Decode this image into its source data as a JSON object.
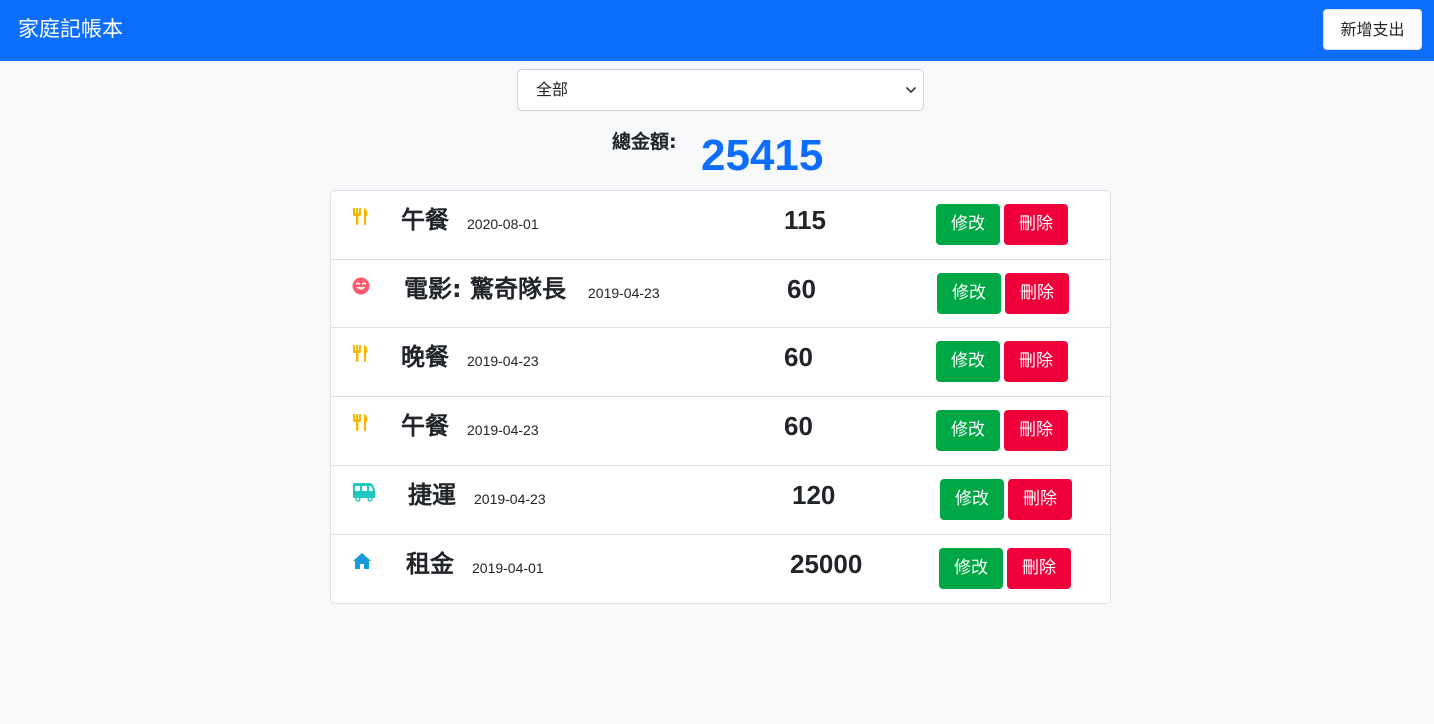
{
  "navbar": {
    "brand": "家庭記帳本",
    "add_button": "新增支出"
  },
  "filter": {
    "selected": "全部"
  },
  "summary": {
    "label": "總金額:",
    "total": "25415"
  },
  "row_actions": {
    "edit_label": "修改",
    "delete_label": "刪除"
  },
  "items": [
    {
      "icon": "utensils-icon",
      "icon_color": "#f5b700",
      "name": "午餐",
      "date": "2020-08-01",
      "amount": "115"
    },
    {
      "icon": "smile-icon",
      "icon_color": "#ff5a6e",
      "name": "電影: 驚奇隊長",
      "date": "2019-04-23",
      "amount": "60"
    },
    {
      "icon": "utensils-icon",
      "icon_color": "#f5b700",
      "name": "晚餐",
      "date": "2019-04-23",
      "amount": "60"
    },
    {
      "icon": "utensils-icon",
      "icon_color": "#f5b700",
      "name": "午餐",
      "date": "2019-04-23",
      "amount": "60"
    },
    {
      "icon": "bus-icon",
      "icon_color": "#20c9c0",
      "name": "捷運",
      "date": "2019-04-23",
      "amount": "120"
    },
    {
      "icon": "home-icon",
      "icon_color": "#1a9bd7",
      "name": "租金",
      "date": "2019-04-01",
      "amount": "25000"
    }
  ]
}
